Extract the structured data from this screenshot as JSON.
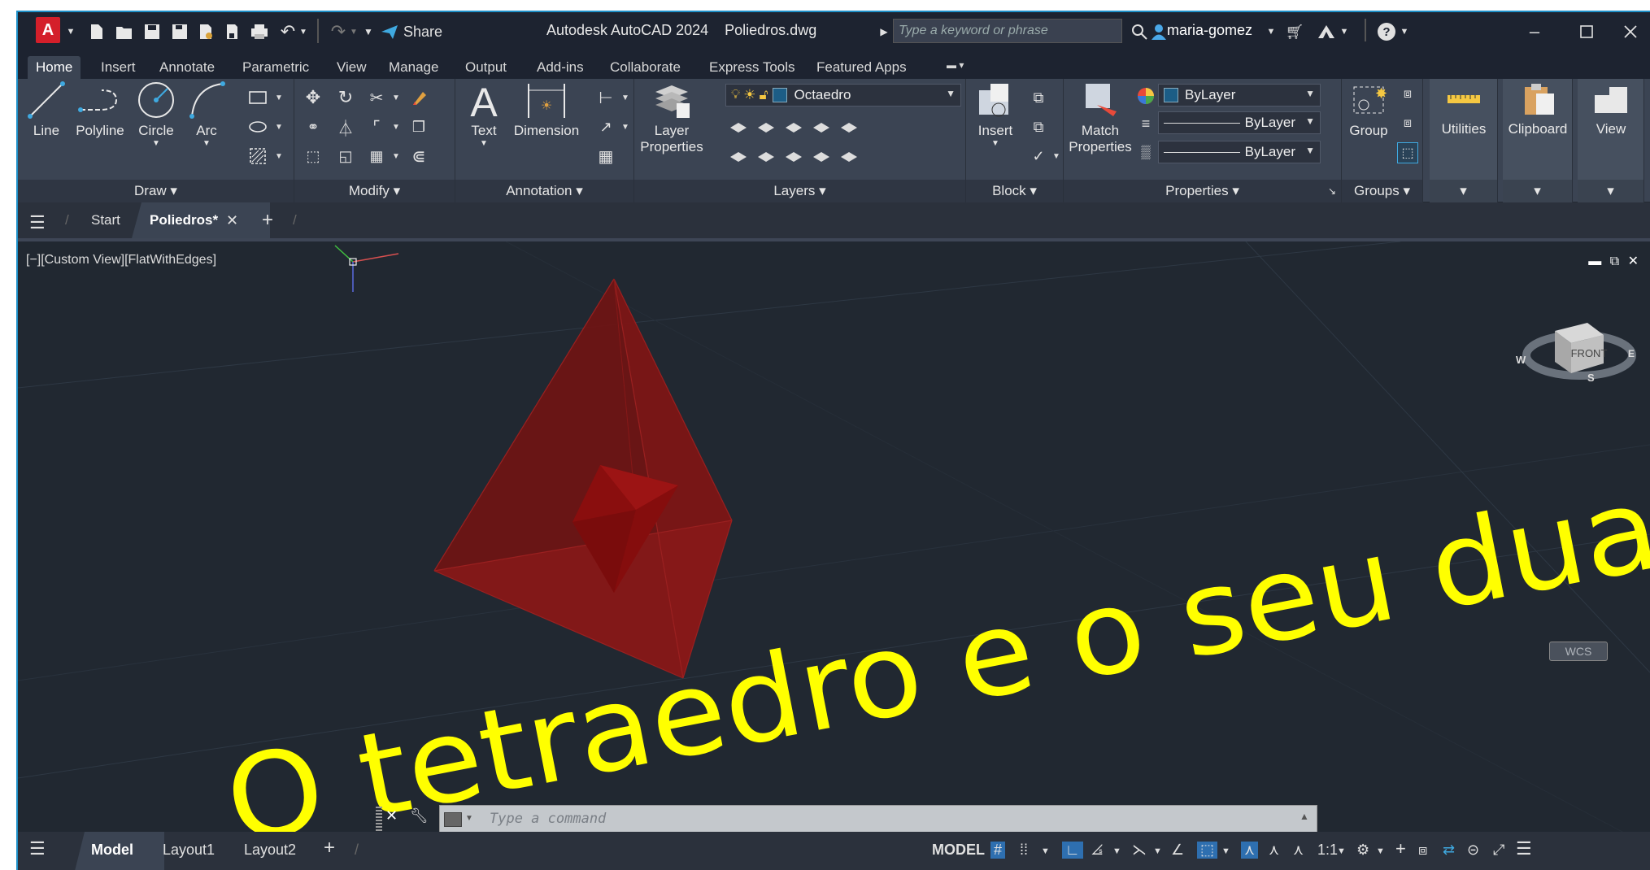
{
  "titlebar": {
    "logo_letter": "A",
    "share_label": "Share",
    "app_title": "Autodesk AutoCAD 2024    Poliedros.dwg",
    "search_placeholder": "Type a keyword or phrase",
    "username": "maria-gomez"
  },
  "menu_tabs": [
    "Home",
    "Insert",
    "Annotate",
    "Parametric",
    "View",
    "Manage",
    "Output",
    "Add-ins",
    "Collaborate",
    "Express Tools",
    "Featured Apps"
  ],
  "ribbon": {
    "draw": {
      "title": "Draw",
      "line": "Line",
      "polyline": "Polyline",
      "circle": "Circle",
      "arc": "Arc"
    },
    "modify": {
      "title": "Modify"
    },
    "annotation": {
      "title": "Annotation",
      "text": "Text",
      "dimension": "Dimension"
    },
    "layers": {
      "title": "Layers",
      "layer_properties_1": "Layer",
      "layer_properties_2": "Properties",
      "current_layer": "Octaedro"
    },
    "block": {
      "title": "Block",
      "insert": "Insert"
    },
    "properties": {
      "title": "Properties",
      "match_1": "Match",
      "match_2": "Properties",
      "color": "ByLayer",
      "linetype": "ByLayer",
      "lineweight": "ByLayer"
    },
    "groups": {
      "title": "Groups",
      "group": "Group"
    },
    "utilities": "Utilities",
    "clipboard": "Clipboard",
    "view": "View"
  },
  "filetabs": {
    "start": "Start",
    "active": "Poliedros*"
  },
  "viewport": {
    "label": "[−][Custom View][FlatWithEdges]",
    "viewcube_face": "FRONT",
    "compass": {
      "w": "W",
      "s": "S",
      "e": "E"
    },
    "wcs": "WCS",
    "drawing_text": "O tetraedro e o seu dua"
  },
  "command": {
    "placeholder": "Type a command"
  },
  "layouttabs": {
    "model": "Model",
    "layout1": "Layout1",
    "layout2": "Layout2"
  },
  "status": {
    "model": "MODEL",
    "scale": "1:1"
  },
  "colors": {
    "accent": "#1e90c8",
    "solid": "#8b0f0f",
    "text_yellow": "#ffff00",
    "viewport_bg": "#212831"
  }
}
